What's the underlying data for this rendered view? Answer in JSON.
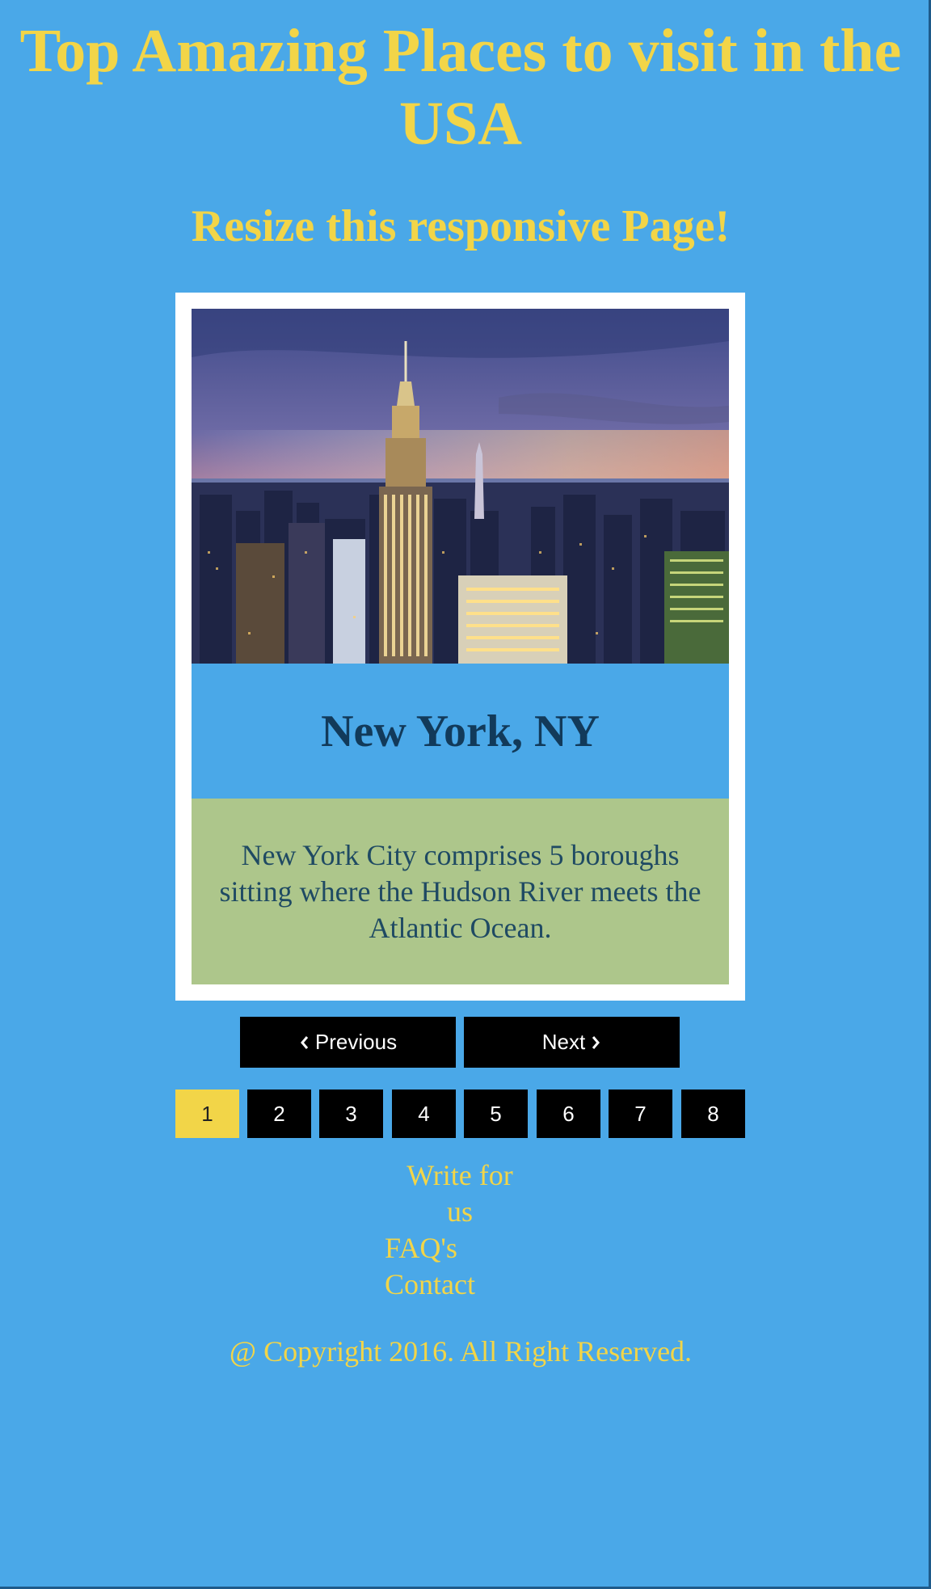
{
  "header": {
    "title": "Top Amazing Places to visit in the USA",
    "subtitle": "Resize this responsive Page!"
  },
  "card": {
    "image_alt": "New York City skyline at sunset",
    "heading": "New York, NY",
    "description": "New York City comprises 5 boroughs sitting where the Hudson River meets the Atlantic Ocean."
  },
  "navigation": {
    "previous_label": "Previous",
    "next_label": "Next"
  },
  "pager": {
    "pages": [
      "1",
      "2",
      "3",
      "4",
      "5",
      "6",
      "7",
      "8"
    ],
    "active_page": "1"
  },
  "footer": {
    "links": {
      "write": "Write for us",
      "faq": "FAQ's",
      "contact": "Contact"
    },
    "copyright": "@ Copyright 2016. All Right Reserved."
  },
  "colors": {
    "background": "#4aa8e8",
    "accent_yellow": "#f2d548",
    "heading_dark": "#123a5a",
    "description_bg": "#adc68b",
    "button_black": "#000000"
  }
}
